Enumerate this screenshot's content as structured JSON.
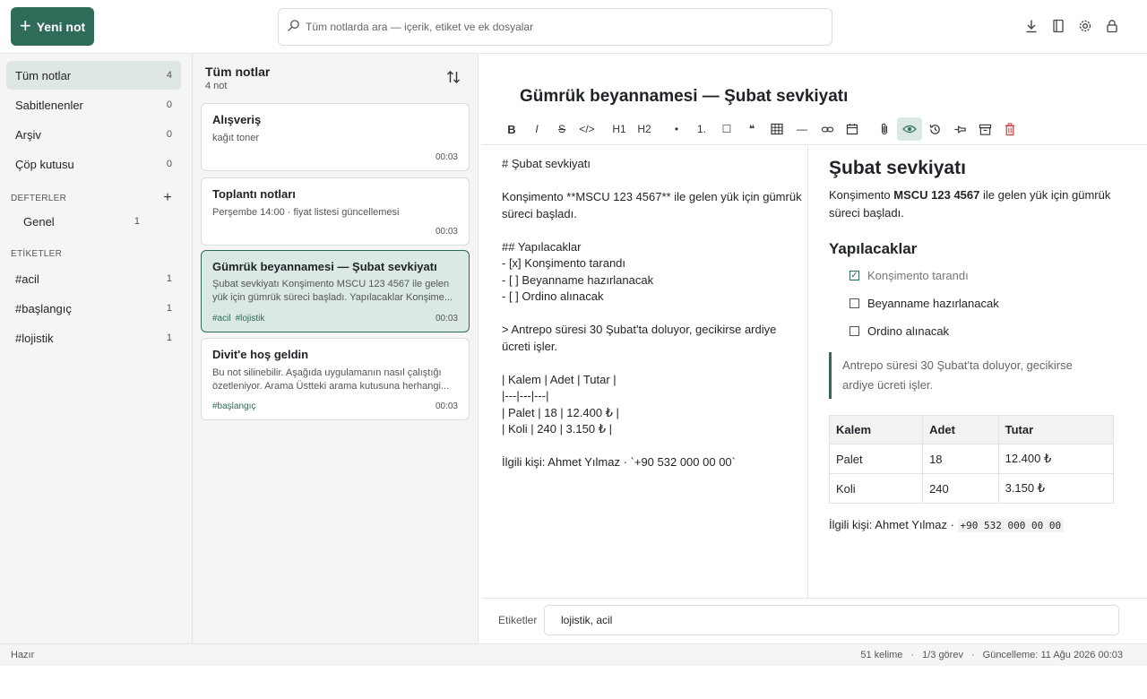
{
  "header": {
    "new_note_label": "Yeni not",
    "search_placeholder": "Tüm notlarda ara — içerik, etiket ve ek dosyalar",
    "icons": [
      "download-icon",
      "book-icon",
      "gear-icon",
      "lock-icon"
    ]
  },
  "sidebar": {
    "items": [
      {
        "label": "Tüm notlar",
        "count": "4"
      },
      {
        "label": "Sabitlenenler",
        "count": "0"
      },
      {
        "label": "Arşiv",
        "count": "0"
      },
      {
        "label": "Çöp kutusu",
        "count": "0"
      }
    ],
    "notebooks_title": "DEFTERLER",
    "notebooks": [
      {
        "label": "Genel",
        "count": "1"
      }
    ],
    "tags_title": "ETİKETLER",
    "tags": [
      {
        "label": "#acil",
        "count": "1"
      },
      {
        "label": "#başlangıç",
        "count": "1"
      },
      {
        "label": "#lojistik",
        "count": "1"
      }
    ]
  },
  "notelist": {
    "title": "Tüm notlar",
    "count": "4 not",
    "notes": [
      {
        "title": "Alışveriş",
        "snippet": "kağıt toner",
        "tags": [],
        "time": "00:03"
      },
      {
        "title": "Toplantı notları",
        "snippet": "Perşembe 14:00 · fiyat listesi güncellemesi",
        "tags": [],
        "time": "00:03"
      },
      {
        "title": "Gümrük beyannamesi — Şubat sevkiyatı",
        "snippet": "Şubat sevkiyatı Konşimento MSCU 123 4567 ile gelen yük için gümrük süreci başladı. Yapılacaklar Konşime...",
        "tags": [
          "#acil",
          "#lojistik"
        ],
        "time": "00:03"
      },
      {
        "title": "Divit'e hoş geldin",
        "snippet": "Bu not silinebilir. Aşağıda uygulamanın nasıl çalıştığı özetleniyor. Arama Üstteki arama kutusuna herhangi...",
        "tags": [
          "#başlangıç"
        ],
        "time": "00:03"
      }
    ]
  },
  "editor": {
    "title": "Gümrük beyannamesi — Şubat sevkiyatı",
    "toolbar": {
      "bold": "B",
      "italic": "I",
      "strike": "S",
      "code": "</>",
      "h1": "H1",
      "h2": "H2",
      "bullet": "•",
      "numbered": "1.",
      "checkbox": "☐",
      "quote": "❝",
      "rule": "—"
    },
    "source": "# Şubat sevkiyatı\n\nKonşimento **MSCU 123 4567** ile gelen yük için gümrük süreci başladı.\n\n## Yapılacaklar\n- [x] Konşimento tarandı\n- [ ] Beyanname hazırlanacak\n- [ ] Ordino alınacak\n\n> Antrepo süresi 30 Şubat'ta doluyor, gecikirse ardiye ücreti işler.\n\n| Kalem | Adet | Tutar |\n|---|---|---|\n| Palet | 18 | 12.400 ₺ |\n| Koli | 240 | 3.150 ₺ |\n\nİlgili kişi: Ahmet Yılmaz · `+90 532 000 00 00`",
    "preview": {
      "h1": "Şubat sevkiyatı",
      "p_before": "Konşimento ",
      "p_bold": "MSCU 123 4567",
      "p_after": " ile gelen yük için gümrük süreci başladı.",
      "h2": "Yapılacaklar",
      "tasks": [
        {
          "label": "Konşimento tarandı",
          "done": true
        },
        {
          "label": "Beyanname hazırlanacak",
          "done": false
        },
        {
          "label": "Ordino alınacak",
          "done": false
        }
      ],
      "quote": "Antrepo süresi 30 Şubat'ta doluyor, gecikirse ardiye ücreti işler.",
      "table": {
        "headers": [
          "Kalem",
          "Adet",
          "Tutar"
        ],
        "rows": [
          [
            "Palet",
            "18",
            "12.400 ₺"
          ],
          [
            "Koli",
            "240",
            "3.150 ₺"
          ]
        ]
      },
      "foot_text": "İlgili kişi: Ahmet Yılmaz · ",
      "foot_code": "+90 532 000 00 00"
    },
    "tags_label": "Etiketler",
    "tags_value": "lojistik, acil"
  },
  "status": {
    "left": "Hazır",
    "words": "51 kelime",
    "tasks": "1/3 görev",
    "updated": "Güncelleme: 11 Ağu 2026 00:03",
    "sep": "·"
  },
  "colors": {
    "accent": "#2e6b58",
    "danger": "#d03b3b"
  }
}
